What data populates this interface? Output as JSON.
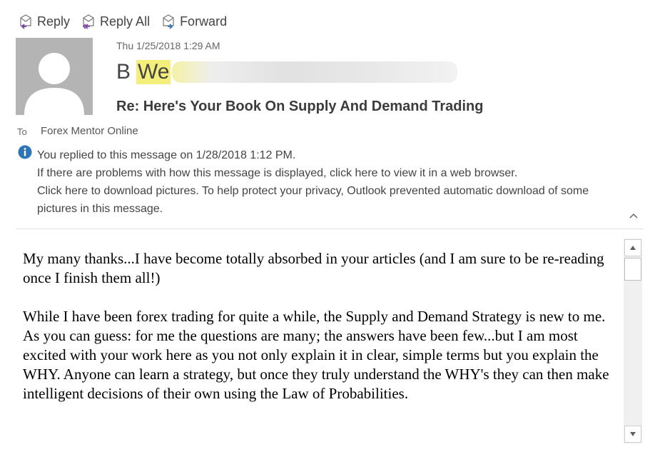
{
  "toolbar": {
    "reply_label": "Reply",
    "reply_all_label": "Reply All",
    "forward_label": "Forward"
  },
  "message": {
    "date": "Thu 1/25/2018 1:29 AM",
    "sender_initial": "B",
    "sender_visible": "We",
    "subject": "Re: Here's Your Book On Supply And Demand Trading",
    "to_label": "To",
    "to_value": "Forex Mentor Online"
  },
  "info": {
    "replied": "You replied to this message on 1/28/2018 1:12 PM.",
    "display_problem": "If there are problems with how this message is displayed, click here to view it in a web browser.",
    "pictures": "Click here to download pictures. To help protect your privacy, Outlook prevented automatic download of some pictures in this message."
  },
  "body": {
    "paragraph1": "My many thanks...I have become totally absorbed in your articles (and I am sure to be re-reading once I finish them all!)",
    "paragraph2": "While I have been forex trading for quite a while, the Supply and Demand Strategy is new to me.  As you can guess: for me the questions are many; the answers have been few...but I am most excited with your work here as you not only explain it in clear, simple terms but you explain the WHY.   Anyone can learn a strategy, but once they truly understand the WHY's they can then make intelligent decisions of their own using the Law of Probabilities."
  },
  "icons": {
    "reply": "reply-icon",
    "reply_all": "reply-all-icon",
    "forward": "forward-icon",
    "info": "info-icon",
    "collapse": "chevron-up-icon"
  },
  "colors": {
    "highlight": "#f4ef7a",
    "info_blue": "#2e75b6",
    "avatar_bg": "#b4b4b4"
  }
}
